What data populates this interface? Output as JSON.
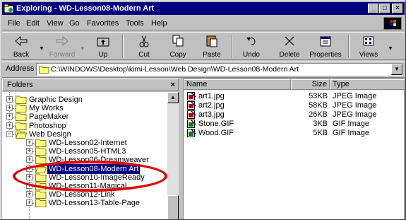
{
  "window": {
    "title": "Exploring - WD-Lesson08-Modern Art",
    "controls": [
      "_",
      "□",
      "×"
    ]
  },
  "menubar": {
    "items": [
      "File",
      "Edit",
      "View",
      "Go",
      "Favorites",
      "Tools",
      "Help"
    ]
  },
  "toolbar": {
    "back": "Back",
    "forward": "Forward",
    "up": "Up",
    "cut": "Cut",
    "copy": "Copy",
    "paste": "Paste",
    "undo": "Undo",
    "delete": "Delete",
    "properties": "Properties",
    "views": "Views"
  },
  "address": {
    "label": "Address",
    "value": "C:\\WINDOWS\\Desktop\\kimi-Lesson\\Web Design\\WD-Lesson08-Modern Art"
  },
  "folders_pane": {
    "header": "Folders",
    "close": "×",
    "nodes": [
      {
        "label": "Graphic Design",
        "expander": "+"
      },
      {
        "label": "My Works",
        "expander": "+"
      },
      {
        "label": "PageMaker",
        "expander": "+"
      },
      {
        "label": "Photoshop",
        "expander": "+"
      },
      {
        "label": "Web Design",
        "expander": "−"
      },
      {
        "label": "WD-Lesson02-Internet",
        "expander": "+"
      },
      {
        "label": "WD-Lesson05-HTML3",
        "expander": "+"
      },
      {
        "label": "WD-Lesson06-Dreamweaver",
        "expander": "+"
      },
      {
        "label": "WD-Lesson08-Modern Art",
        "expander": "+",
        "selected": true
      },
      {
        "label": "WD-Lesson10-ImageReady",
        "expander": "+"
      },
      {
        "label": "WD-Lesson11-Magical",
        "expander": "+"
      },
      {
        "label": "WD-Lesson12-Link",
        "expander": "+"
      },
      {
        "label": "WD-Lesson13-Table-Page",
        "expander": "+"
      }
    ]
  },
  "files_pane": {
    "columns": [
      "Name",
      "Size",
      "Type"
    ],
    "rows": [
      {
        "name": "art1.jpg",
        "size": "53KB",
        "type": "JPEG Image"
      },
      {
        "name": "art2.jpg",
        "size": "58KB",
        "type": "JPEG Image"
      },
      {
        "name": "art3.jpg",
        "size": "26KB",
        "type": "JPEG Image"
      },
      {
        "name": "Stone.GIF",
        "size": "3KB",
        "type": "GIF Image"
      },
      {
        "name": "Wood.GIF",
        "size": "5KB",
        "type": "GIF Image"
      }
    ]
  },
  "colors": {
    "titlebar": "#000080",
    "selection": "#000080",
    "highlight_ring": "#e00000",
    "folder": "#ffff80"
  }
}
